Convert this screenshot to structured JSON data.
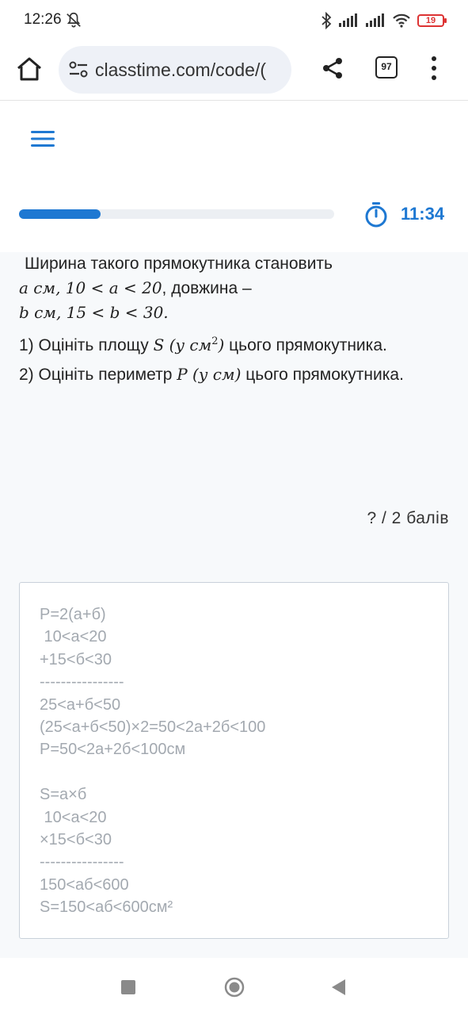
{
  "status_bar": {
    "time": "12:26",
    "battery": "19",
    "icons": [
      "bell-off-icon",
      "bluetooth-icon",
      "signal-icon",
      "signal-icon",
      "wifi-icon",
      "battery-icon"
    ]
  },
  "browser": {
    "url": "classtime.com/code/(",
    "tab_count": "97"
  },
  "progress": {
    "fraction": 0.26,
    "timer": "11:34"
  },
  "question": {
    "line1_text": "Ширина такого прямокутника становить",
    "line2_math": "a см,  10 < a < 20",
    "line2_text": ", довжина –",
    "line3_math": "b см,  15 < b < 30.",
    "item1_prefix": "1) Оцініть площу ",
    "item1_math_var": "S",
    "item1_math_unit": " (у см",
    "item1_math_sup": "2",
    "item1_math_close": ")",
    "item1_suffix": " цього прямокутника.",
    "item2_prefix": "2) Оцініть периметр ",
    "item2_math_var": "P",
    "item2_math_unit": " (у см)",
    "item2_suffix": " цього прямокутника."
  },
  "score": "?  /  2  балів",
  "answer": {
    "lines": [
      "P=2(a+б)",
      " 10<a<20",
      "+15<б<30",
      "----------------",
      "25<a+б<50",
      "(25<a+б<50)×2=50<2a+2б<100",
      "P=50<2a+2б<100см",
      "",
      "S=a×б",
      " 10<a<20",
      "×15<б<30",
      "----------------",
      "150<aб<600",
      "S=150<aб<600см²"
    ]
  }
}
